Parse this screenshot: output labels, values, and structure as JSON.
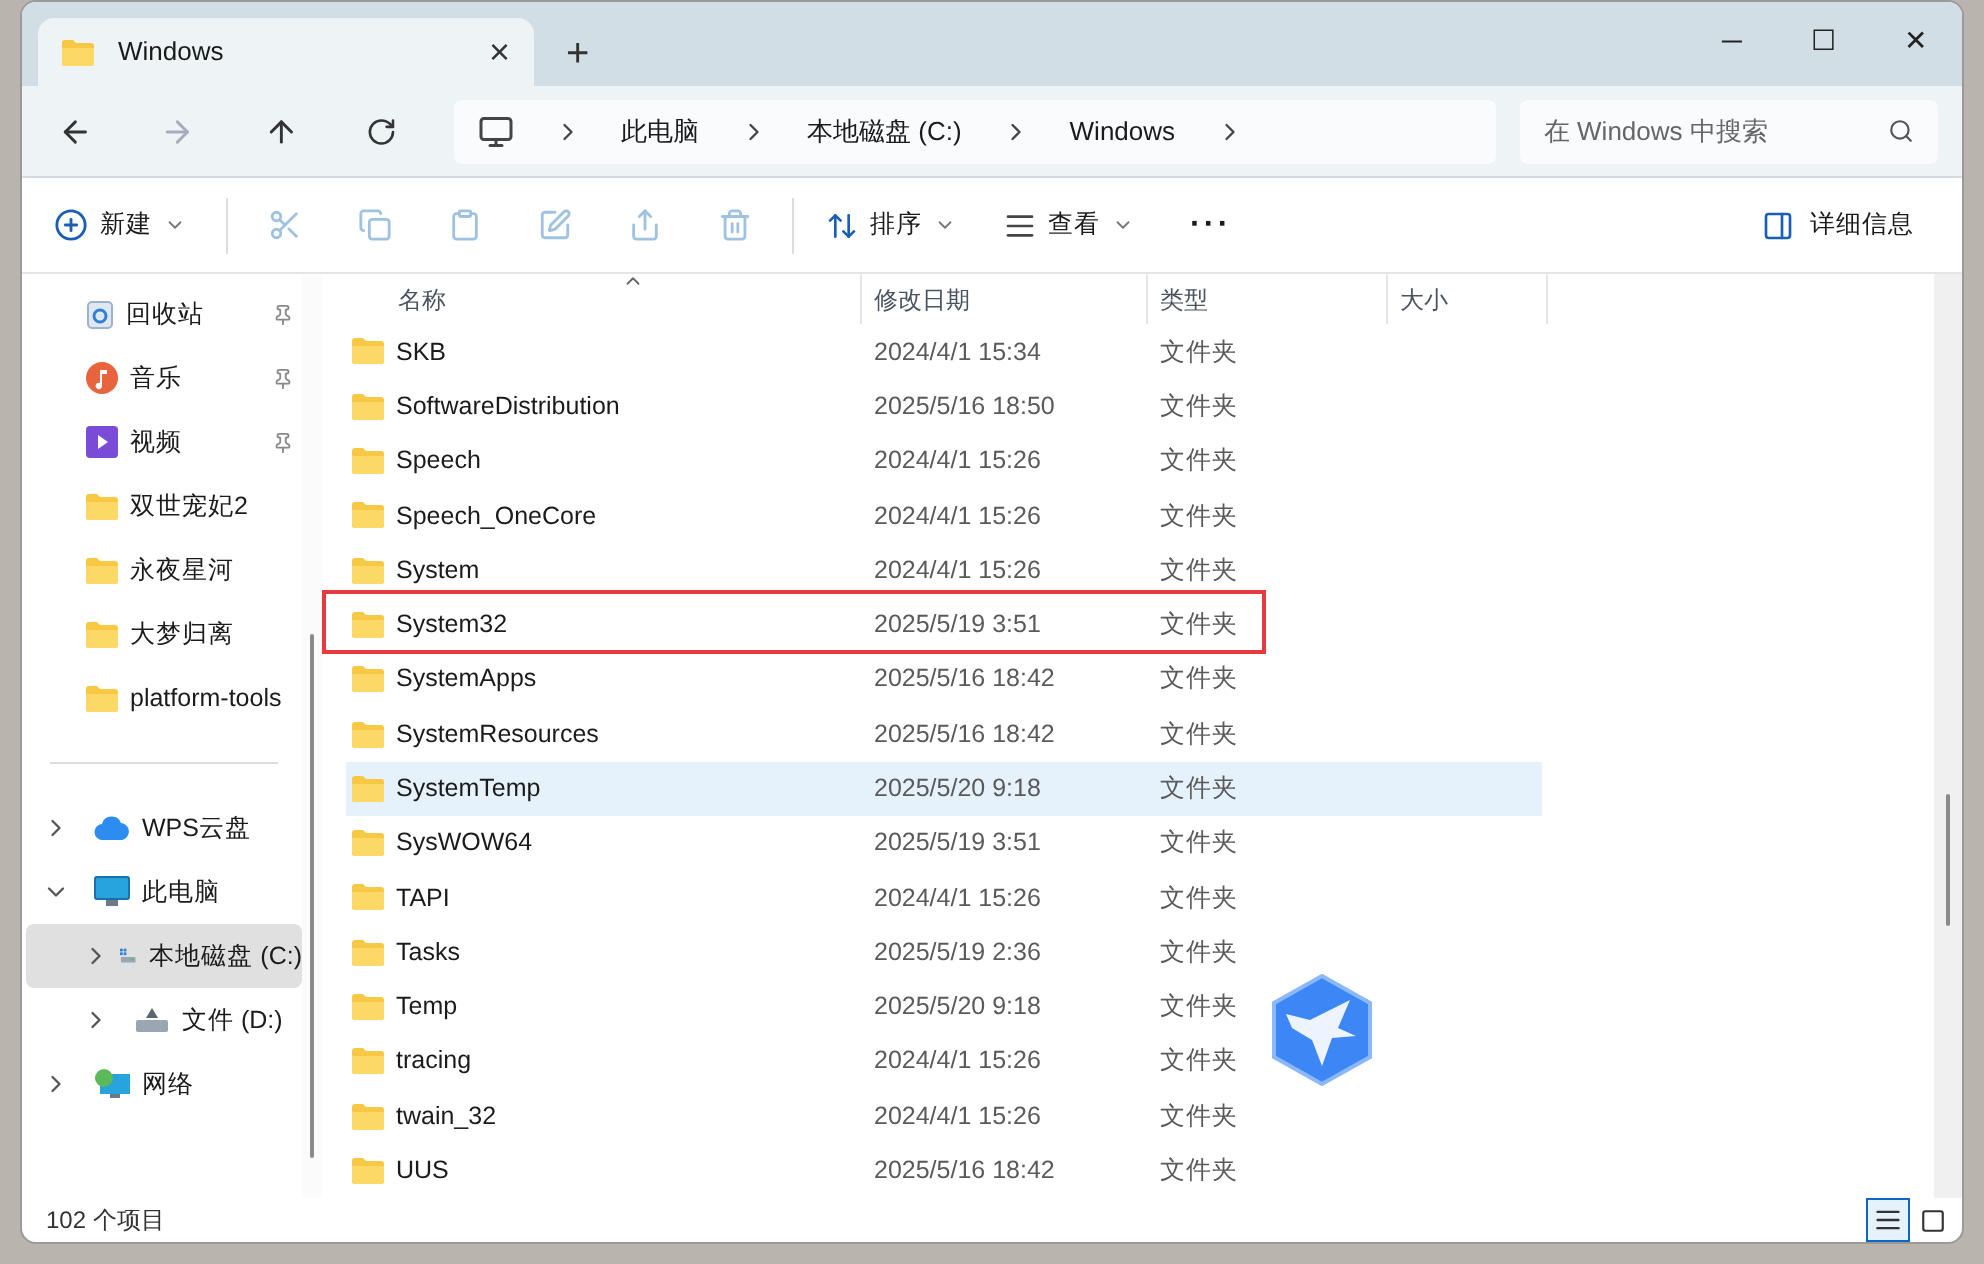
{
  "tab": {
    "title": "Windows",
    "close": "×",
    "new": "+"
  },
  "window_controls": [
    "─",
    "☐",
    "✕"
  ],
  "breadcrumb": [
    "此电脑",
    "本地磁盘 (C:)",
    "Windows"
  ],
  "search": {
    "placeholder": "在 Windows 中搜索"
  },
  "toolbar": {
    "new": "新建",
    "sort": "排序",
    "view": "查看",
    "more": "···",
    "details": "详细信息"
  },
  "sidebar": {
    "quick": [
      {
        "label": "回收站",
        "kind": "recycle",
        "pinned": true
      },
      {
        "label": "音乐",
        "kind": "music",
        "pinned": true
      },
      {
        "label": "视频",
        "kind": "video",
        "pinned": true
      },
      {
        "label": "双世宠妃2",
        "kind": "folder",
        "pinned": false
      },
      {
        "label": "永夜星河",
        "kind": "folder",
        "pinned": false
      },
      {
        "label": "大梦归离",
        "kind": "folder",
        "pinned": false
      },
      {
        "label": "platform-tools",
        "kind": "folder",
        "pinned": false
      }
    ],
    "tree": [
      {
        "label": "WPS云盘",
        "kind": "cloud",
        "expanded": false,
        "selected": false
      },
      {
        "label": "此电脑",
        "kind": "pc",
        "expanded": true,
        "selected": false,
        "children": [
          {
            "label": "本地磁盘 (C:)",
            "kind": "drive",
            "expanded": false,
            "selected": true
          },
          {
            "label": "文件 (D:)",
            "kind": "drive2",
            "expanded": false,
            "selected": false
          }
        ]
      },
      {
        "label": "网络",
        "kind": "network",
        "expanded": false,
        "selected": false
      }
    ]
  },
  "table": {
    "columns": [
      "名称",
      "修改日期",
      "类型",
      "大小"
    ],
    "rows": [
      {
        "name": "SKB",
        "date": "2024/4/1 15:34",
        "type": "文件夹",
        "selected": false,
        "outlined": false
      },
      {
        "name": "SoftwareDistribution",
        "date": "2025/5/16 18:50",
        "type": "文件夹",
        "selected": false,
        "outlined": false
      },
      {
        "name": "Speech",
        "date": "2024/4/1 15:26",
        "type": "文件夹",
        "selected": false,
        "outlined": false
      },
      {
        "name": "Speech_OneCore",
        "date": "2024/4/1 15:26",
        "type": "文件夹",
        "selected": false,
        "outlined": false
      },
      {
        "name": "System",
        "date": "2024/4/1 15:26",
        "type": "文件夹",
        "selected": false,
        "outlined": false
      },
      {
        "name": "System32",
        "date": "2025/5/19 3:51",
        "type": "文件夹",
        "selected": false,
        "outlined": true
      },
      {
        "name": "SystemApps",
        "date": "2025/5/16 18:42",
        "type": "文件夹",
        "selected": false,
        "outlined": false
      },
      {
        "name": "SystemResources",
        "date": "2025/5/16 18:42",
        "type": "文件夹",
        "selected": false,
        "outlined": false
      },
      {
        "name": "SystemTemp",
        "date": "2025/5/20 9:18",
        "type": "文件夹",
        "selected": true,
        "outlined": false
      },
      {
        "name": "SysWOW64",
        "date": "2025/5/19 3:51",
        "type": "文件夹",
        "selected": false,
        "outlined": false
      },
      {
        "name": "TAPI",
        "date": "2024/4/1 15:26",
        "type": "文件夹",
        "selected": false,
        "outlined": false
      },
      {
        "name": "Tasks",
        "date": "2025/5/19 2:36",
        "type": "文件夹",
        "selected": false,
        "outlined": false
      },
      {
        "name": "Temp",
        "date": "2025/5/20 9:18",
        "type": "文件夹",
        "selected": false,
        "outlined": false
      },
      {
        "name": "tracing",
        "date": "2024/4/1 15:26",
        "type": "文件夹",
        "selected": false,
        "outlined": false
      },
      {
        "name": "twain_32",
        "date": "2024/4/1 15:26",
        "type": "文件夹",
        "selected": false,
        "outlined": false
      },
      {
        "name": "UUS",
        "date": "2025/5/16 18:42",
        "type": "文件夹",
        "selected": false,
        "outlined": false
      }
    ]
  },
  "status_bar": {
    "count": "102 个项目",
    "views": [
      {
        "kind": "details",
        "selected": true
      },
      {
        "kind": "tiles",
        "selected": false
      }
    ]
  }
}
